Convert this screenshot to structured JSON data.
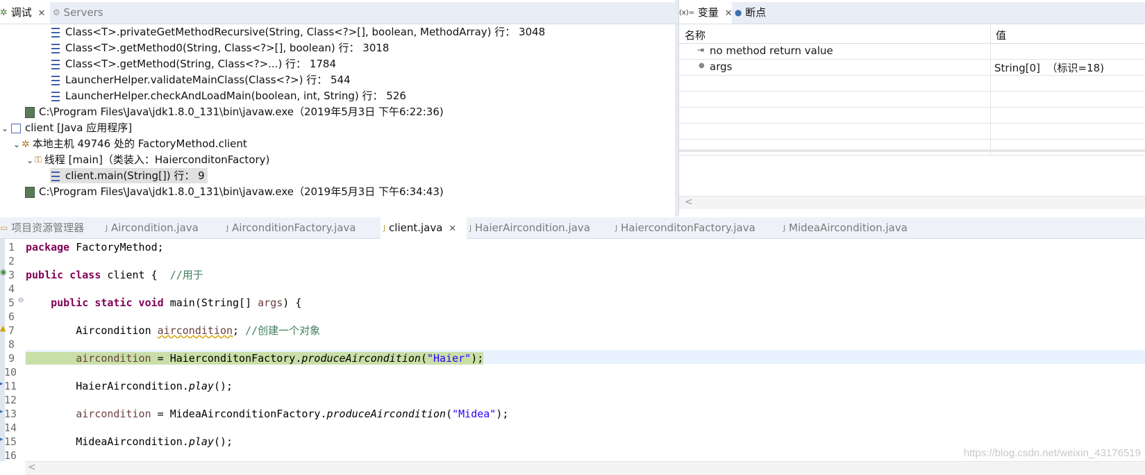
{
  "debug_panel": {
    "tabs": [
      {
        "label": "调试",
        "active": true
      },
      {
        "label": "Servers",
        "active": false
      }
    ],
    "tree": [
      {
        "kind": "frame",
        "text": "Class<T>.privateGetMethodRecursive(String, Class<?>[], boolean, MethodArray) 行： 3048"
      },
      {
        "kind": "frame",
        "text": "Class<T>.getMethod0(String, Class<?>[], boolean) 行： 3018"
      },
      {
        "kind": "frame",
        "text": "Class<T>.getMethod(String, Class<?>...) 行： 1784"
      },
      {
        "kind": "frame",
        "text": "LauncherHelper.validateMainClass(Class<?>) 行： 544"
      },
      {
        "kind": "frame",
        "text": "LauncherHelper.checkAndLoadMain(boolean, int, String) 行： 526"
      },
      {
        "kind": "process",
        "text": "C:\\Program Files\\Java\\jdk1.8.0_131\\bin\\javaw.exe（2019年5月3日 下午6:22:36)"
      },
      {
        "kind": "launch",
        "text": "client [Java 应用程序]"
      },
      {
        "kind": "target",
        "text": "本地主机 49746 处的 FactoryMethod.client"
      },
      {
        "kind": "thread",
        "text": "线程 [main]（类装入：HaierconditonFactory)"
      },
      {
        "kind": "frame",
        "text": "client.main(String[]) 行： 9"
      },
      {
        "kind": "process",
        "text": "C:\\Program Files\\Java\\jdk1.8.0_131\\bin\\javaw.exe（2019年5月3日 下午6:34:43)"
      }
    ]
  },
  "variables_panel": {
    "tabs": [
      {
        "label": "变量",
        "active": true
      },
      {
        "label": "断点",
        "active": false
      }
    ],
    "col_name": "名称",
    "col_value": "值",
    "rows": [
      {
        "name": "no method return value",
        "value": ""
      },
      {
        "name": "args",
        "value": "String[0]  （标识=18)"
      }
    ],
    "scroll_left": "<"
  },
  "editor": {
    "tabs": [
      {
        "label": "项目资源管理器",
        "active": false
      },
      {
        "label": "Aircondition.java",
        "active": false
      },
      {
        "label": "AirconditionFactory.java",
        "active": false
      },
      {
        "label": "client.java",
        "active": true
      },
      {
        "label": "HaierAircondition.java",
        "active": false
      },
      {
        "label": "HaierconditonFactory.java",
        "active": false
      },
      {
        "label": "MideaAircondition.java",
        "active": false
      }
    ],
    "line_numbers": [
      "1",
      "2",
      "3",
      "4",
      "5",
      "6",
      "7",
      "8",
      "9",
      "10",
      "11",
      "12",
      "13",
      "14",
      "15",
      "16"
    ],
    "code": {
      "l1_kw": "package",
      "l1_rest": " FactoryMethod;",
      "l3_kw": "public class",
      "l3_rest": " client {  ",
      "l3_comment": "//用于",
      "l5_kw": "public static void",
      "l5_rest": " main(String[] ",
      "l5_var": "args",
      "l5_end": ") {",
      "l7_type": "Aircondition ",
      "l7_var": "aircondition",
      "l7_end": "; ",
      "l7_comment": "//创建一个对象",
      "l9_var": "aircondition",
      "l9_mid": " = HaierconditonFactory.",
      "l9_method": "produceAircondition",
      "l9_open": "(",
      "l9_str": "\"Haier\"",
      "l9_end": ");",
      "l11_cls": "HaierAircondition.",
      "l11_method": "play",
      "l11_end": "();",
      "l13_var": "aircondition",
      "l13_mid": " = MideaAirconditionFactory.",
      "l13_method": "produceAircondition",
      "l13_open": "(",
      "l13_str": "\"Midea\"",
      "l13_end": ");",
      "l15_cls": "MideaAircondition.",
      "l15_method": "play",
      "l15_end": "();"
    },
    "scroll_left": "<"
  },
  "watermark": "https://blog.csdn.net/weixin_43176519",
  "colors": {
    "keyword": "#7f0055",
    "comment": "#3f7f5f",
    "string": "#2a00ff",
    "current_line": "#c9dfa8",
    "tab_bg": "#e9eef6"
  }
}
